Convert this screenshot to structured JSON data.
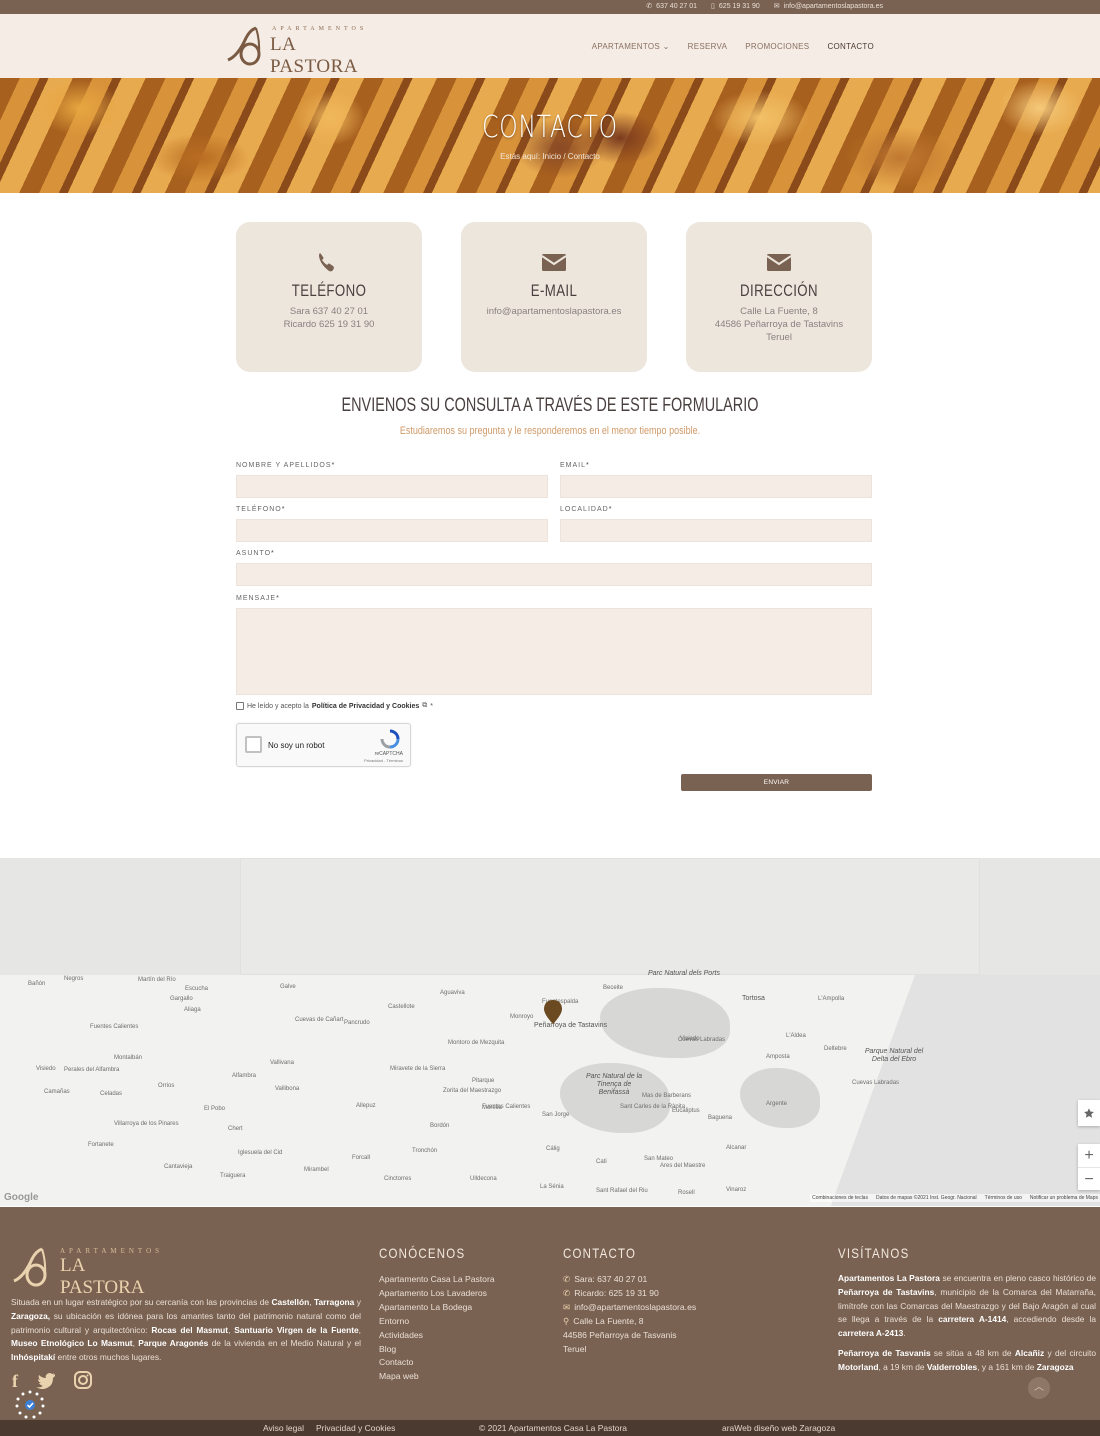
{
  "topbar": {
    "phone1": "637 40 27 01",
    "phone2": "625 19 31 90",
    "email": "info@apartamentoslapastora.es"
  },
  "logo": {
    "small": "APARTAMENTOS",
    "big": "LA PASTORA"
  },
  "nav": {
    "items": [
      "APARTAMENTOS",
      "RESERVA",
      "PROMOCIONES",
      "CONTACTO"
    ],
    "active": "CONTACTO"
  },
  "hero": {
    "title": "CONTACTO",
    "breadcrumb_home": "Estás aquí: Inicio",
    "breadcrumb_sep": "/",
    "breadcrumb_current": "Contacto"
  },
  "cards": [
    {
      "icon": "phone-icon",
      "title": "TELÉFONO",
      "lines": [
        "Sara 637 40 27 01",
        "Ricardo 625 19 31 90"
      ]
    },
    {
      "icon": "envelope-icon",
      "title": "E-MAIL",
      "lines": [
        "info@apartamentoslapastora.es"
      ]
    },
    {
      "icon": "envelope-icon",
      "title": "DIRECCIÓN",
      "lines": [
        "Calle La Fuente, 8",
        "44586 Peñarroya de Tastavins",
        "Teruel"
      ]
    }
  ],
  "form": {
    "heading": "ENVIENOS SU CONSULTA A TRAVÉS DE ESTE FORMULARIO",
    "subheading": "Estudiaremos su pregunta y le responderemos en el menor tiempo posible.",
    "labels": {
      "name": "NOMBRE Y APELLIDOS",
      "email": "EMAIL",
      "phone": "TELÉFONO",
      "locality": "LOCALIDAD",
      "subject": "ASUNTO",
      "message": "MENSAJE"
    },
    "required_mark": "*",
    "privacy_prefix": "He leído y acepto la",
    "privacy_link": "Política de Privacidad y Cookies",
    "privacy_suffix": "*",
    "captcha_label": "No soy un robot",
    "captcha_brand": "reCAPTCHA",
    "captcha_terms": "Privacidad - Términos",
    "submit": "ENVIAR"
  },
  "map": {
    "towns": [
      "Beceite",
      "Fuentespalda",
      "Peñarroya de Tastavins",
      "Monroyo",
      "Aguaviva",
      "Castellote",
      "Tortosa",
      "L'Ampolla",
      "L'Aldea",
      "Deltebre",
      "Amposta",
      "Alcanar",
      "Vinaroz",
      "Morella",
      "Ejulve",
      "Cuevas de Cañart",
      "Pancrudo",
      "Fuentes Calientes",
      "Montalbán",
      "Utrillas",
      "Escucha",
      "Gargallo",
      "Aliaga",
      "Galve",
      "Camarillas",
      "Orrios",
      "Alfambra",
      "El Pobo",
      "Villarroya de los Pinares",
      "Fortanete",
      "Cantavieja",
      "Iglesuela del Cid",
      "Mirambel",
      "Forcall",
      "Cinctorres",
      "Portell de Morella",
      "Chiva de Morella",
      "Zorita del Maestrazgo",
      "Bordón",
      "Tronchón",
      "Pitarque",
      "Montoro de Mezquita",
      "Miravete de la Sierra",
      "Allepuz",
      "Vallibona",
      "Vallivana",
      "Chert",
      "Traiguera",
      "San Jorge",
      "Cálig",
      "Cati",
      "San Mateo",
      "Ares del Maestre",
      "Rosell",
      "La Sénia",
      "Sant Rafael del Riu",
      "Ulldecona",
      "Sant Carles de la Ràpita",
      "Mas de Barberans",
      "Eucaliptus",
      "Baguena",
      "Argente",
      "Visiedo",
      "Perales del Alfambra",
      "Celadas",
      "Cuevas Labradas",
      "Negros",
      "Martín del Río",
      "Bañón",
      "Camañas"
    ],
    "park_labels": [
      "Parc Natural dels Ports",
      "Parc Natural de la Tinença de Benifassà",
      "Parque Natural del Delta del Ebro"
    ],
    "keyboard": "Combinaciones de teclas",
    "map_data": "Datos de mapas ©2021 Inst. Geogr. Nacional",
    "terms": "Términos de uso",
    "report": "Notificar un problema de Maps",
    "google": "Google",
    "zoom_in": "+",
    "zoom_out": "−"
  },
  "footer": {
    "desc_parts": [
      "Situada en un lugar estratégico por su cercanía con las provincias de ",
      "Castellón",
      ", ",
      "Tarragona",
      " y ",
      "Zaragoza,",
      " su ubicación es idónea para los amantes tanto del patrimonio natural como del patrimonio cultural y arquitectónico: ",
      "Rocas del Masmut",
      ", ",
      "Santuario Virgen de la Fuente",
      ", ",
      "Museo Etnológico Lo Masmut",
      ", ",
      "Parque Aragonés",
      " de la vivienda en el Medio Natural y el ",
      "Inhóspitakí",
      " entre otros muchos lugares."
    ],
    "conocenos_title": "CONÓCENOS",
    "conocenos_links": [
      "Apartamento Casa La Pastora",
      "Apartamento Los Lavaderos",
      "Apartamento La Bodega",
      "Entorno",
      "Actividades",
      "Blog",
      "Contacto",
      "Mapa web"
    ],
    "contacto_title": "CONTACTO",
    "contacto_lines": [
      "Sara: 637 40 27 01",
      "Ricardo: 625 19 31 90",
      "info@apartamentoslapastora.es",
      "Calle La Fuente, 8",
      "44586 Peñarroya de Tasvanis",
      "Teruel"
    ],
    "visitanos_title": "VISÍTANOS",
    "visit_p1_parts": [
      "Apartamentos La Pastora",
      " se encuentra en pleno casco histórico de ",
      "Peñarroya de Tastavins",
      ", municipio de la Comarca del Matarraña, limítrofe con las Comarcas del Maestrazgo y del Bajo Aragón al cual se llega a través de la ",
      "carretera A-1414",
      ", accediendo desde la ",
      "carretera A-2413",
      "."
    ],
    "visit_p2_parts": [
      "Peñarroya de Tasvanis",
      " se sitúa a 48 km de ",
      "Alcañiz",
      " y del circuito ",
      "Motorland",
      ", a 19 km de ",
      "Valderrobles",
      ", y a 161 km de ",
      "Zaragoza"
    ]
  },
  "bottombar": {
    "legal": "Aviso legal",
    "privacy": "Privacidad y Cookies",
    "copyright": "© 2021 Apartamentos Casa La Pastora",
    "credit": "araWeb diseño web Zaragoza"
  },
  "colors": {
    "brand_brown": "#7a6252",
    "dark_brown": "#4a3a30",
    "beige": "#f4ece5",
    "card": "#ede6dd",
    "accent_orange": "#d09a68"
  }
}
